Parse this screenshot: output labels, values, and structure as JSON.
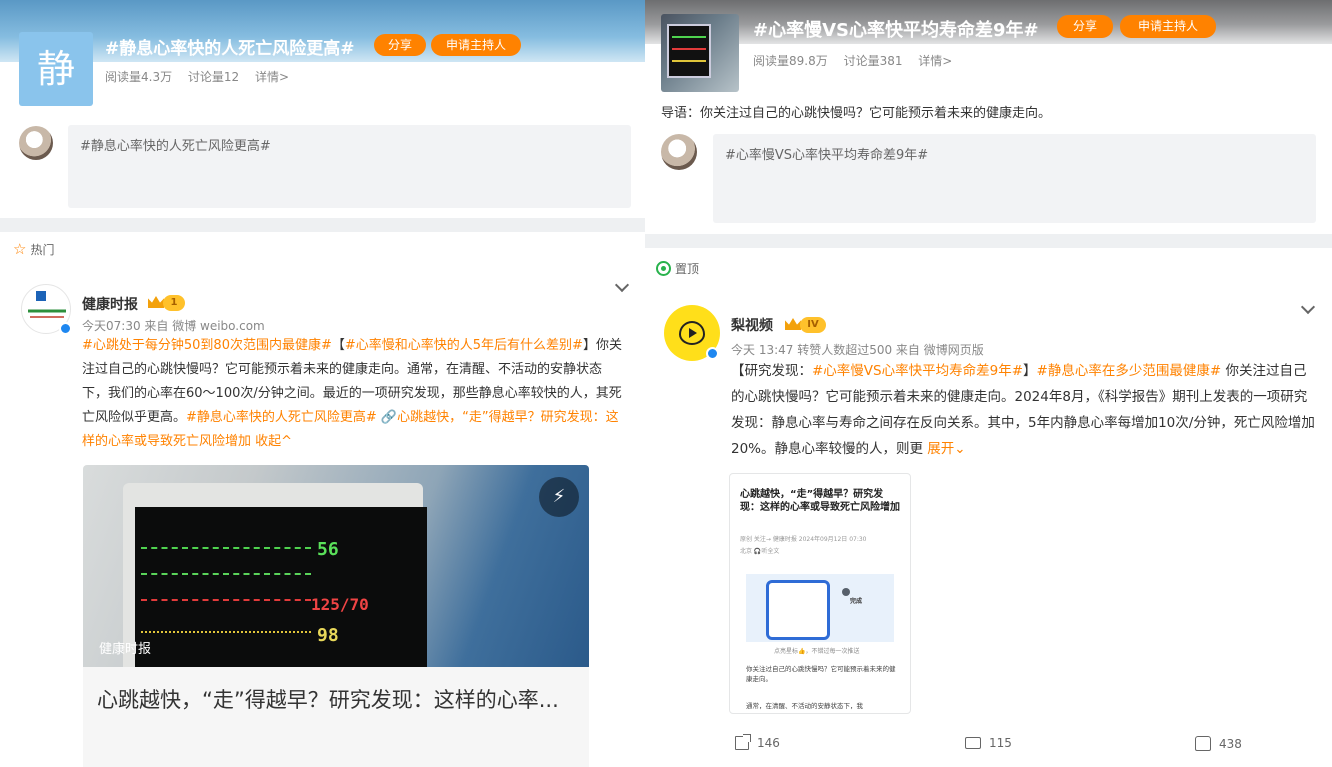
{
  "left": {
    "topic": {
      "thumb_char": "静",
      "title": "#静息心率快的人死亡风险更高#",
      "share_label": "分享",
      "host_label": "申请主持人",
      "reads": "阅读量4.3万",
      "discussions": "讨论量12",
      "details": "详情>"
    },
    "compose_text": "#静息心率快的人死亡风险更高#",
    "section_label": "热门",
    "post": {
      "user_name": "健康时报",
      "badge_level": "1",
      "meta": "今天07:30  来自 微博 weibo.com",
      "text_parts": [
        {
          "hl": true,
          "t": "#心跳处于每分钟50到80次范围内最健康#"
        },
        {
          "hl": false,
          "t": "【"
        },
        {
          "hl": true,
          "t": "#心率慢和心率快的人5年后有什么差别#"
        },
        {
          "hl": false,
          "t": "】你关注过自己的心跳快慢吗？它可能预示着未来的健康走向。通常，在清醒、不活动的安静状态下，我们的心率在60～100次/分钟之间。最近的一项研究发现，那些静息心率较快的人，其死亡风险似乎更高。"
        },
        {
          "hl": true,
          "t": "#静息心率快的人死亡风险更高# 🔗心跳越快，“走”得越早？研究发现：这样的心率或导致死亡风险增加 收起^"
        }
      ],
      "media": {
        "watermark": "健康时报",
        "readout_1": "56",
        "readout_2": "125/70",
        "readout_3": "98",
        "caption": "心跳越快，“走”得越早？研究发现：这样的心率..."
      }
    }
  },
  "right": {
    "topic": {
      "title": "#心率慢VS心率快平均寿命差9年#",
      "share_label": "分享",
      "host_label": "申请主持人",
      "reads": "阅读量89.8万",
      "discussions": "讨论量381",
      "details": "详情>"
    },
    "intro": "导语：你关注过自己的心跳快慢吗？它可能预示着未来的健康走向。",
    "compose_text": "#心率慢VS心率快平均寿命差9年#",
    "section_label": "置顶",
    "post": {
      "user_name": "梨视频",
      "badge_level": "IV",
      "meta": "今天 13:47  转赞人数超过500  来自 微博网页版",
      "text_parts": [
        {
          "hl": false,
          "t": "【研究发现："
        },
        {
          "hl": true,
          "t": "#心率慢VS心率快平均寿命差9年#"
        },
        {
          "hl": false,
          "t": "】"
        },
        {
          "hl": true,
          "t": "#静息心率在多少范围最健康#"
        },
        {
          "hl": false,
          "t": " 你关注过自己的心跳快慢吗？它可能预示着未来的健康走向。2024年8月，《科学报告》期刊上发表的一项研究发现：静息心率与寿命之间存在反向关系。其中，5年内静息心率每增加10次/分钟，死亡风险增加20%。静息心率较慢的人，则更 "
        },
        {
          "hl": true,
          "t": "展开⌄"
        }
      ],
      "article": {
        "title": "心跳越快，“走”得越早？研究发现：这样的心率或导致死亡风险增加",
        "meta": "原创 关注→ 健康时报 2024年09月12日 07:30",
        "meta2": "北京 🎧听全文",
        "done": "完成",
        "caption": "点亮星标👍，不错过每一次推送",
        "para1": "你关注过自己的心跳快慢吗？它可能预示着未来的健康走向。",
        "para2": "通常，在清醒、不活动的安静状态下，我"
      },
      "shares": "146",
      "comments": "115",
      "likes": "438"
    }
  }
}
